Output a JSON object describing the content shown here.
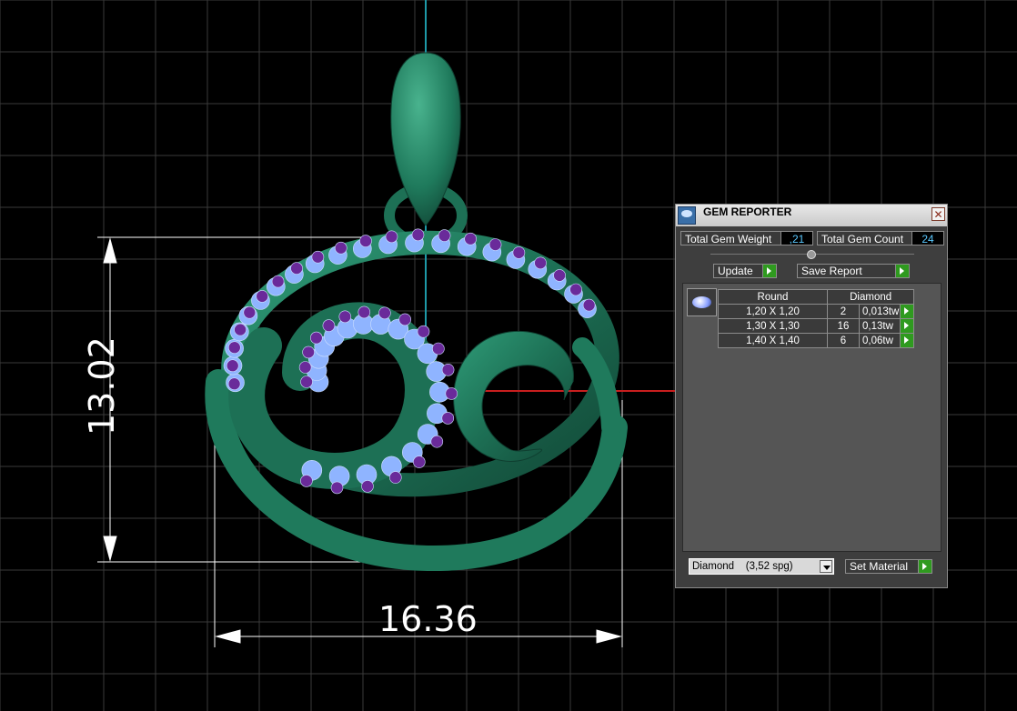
{
  "viewport": {
    "width_dim": "16.36",
    "height_dim": "13.02"
  },
  "gem_reporter": {
    "title": "GEM REPORTER",
    "close_glyph": "✕",
    "total_weight_label": "Total Gem Weight",
    "total_weight_value": ",21",
    "total_count_label": "Total Gem Count",
    "total_count_value": "24",
    "update_label": "Update",
    "save_report_label": "Save Report",
    "table": {
      "headers": [
        "Round",
        "Diamond"
      ],
      "rows": [
        {
          "size": "1,20 X 1,20",
          "count": "2",
          "weight": "0,013tw"
        },
        {
          "size": "1,30 X 1,30",
          "count": "16",
          "weight": "0,13tw"
        },
        {
          "size": "1,40 X 1,40",
          "count": "6",
          "weight": "0,06tw"
        }
      ]
    },
    "material_value": "Diamond    (3,52 spg)",
    "set_material_label": "Set Material"
  },
  "colors": {
    "metal": "#1f7a5c",
    "gem_pave": "#8fb4ff",
    "gem_amethyst": "#6a2a9a",
    "grid": "#3a3a3a",
    "axis_x": "#c81e1e",
    "axis_y": "#1e9aa8",
    "go_button": "#2f9a1f"
  }
}
